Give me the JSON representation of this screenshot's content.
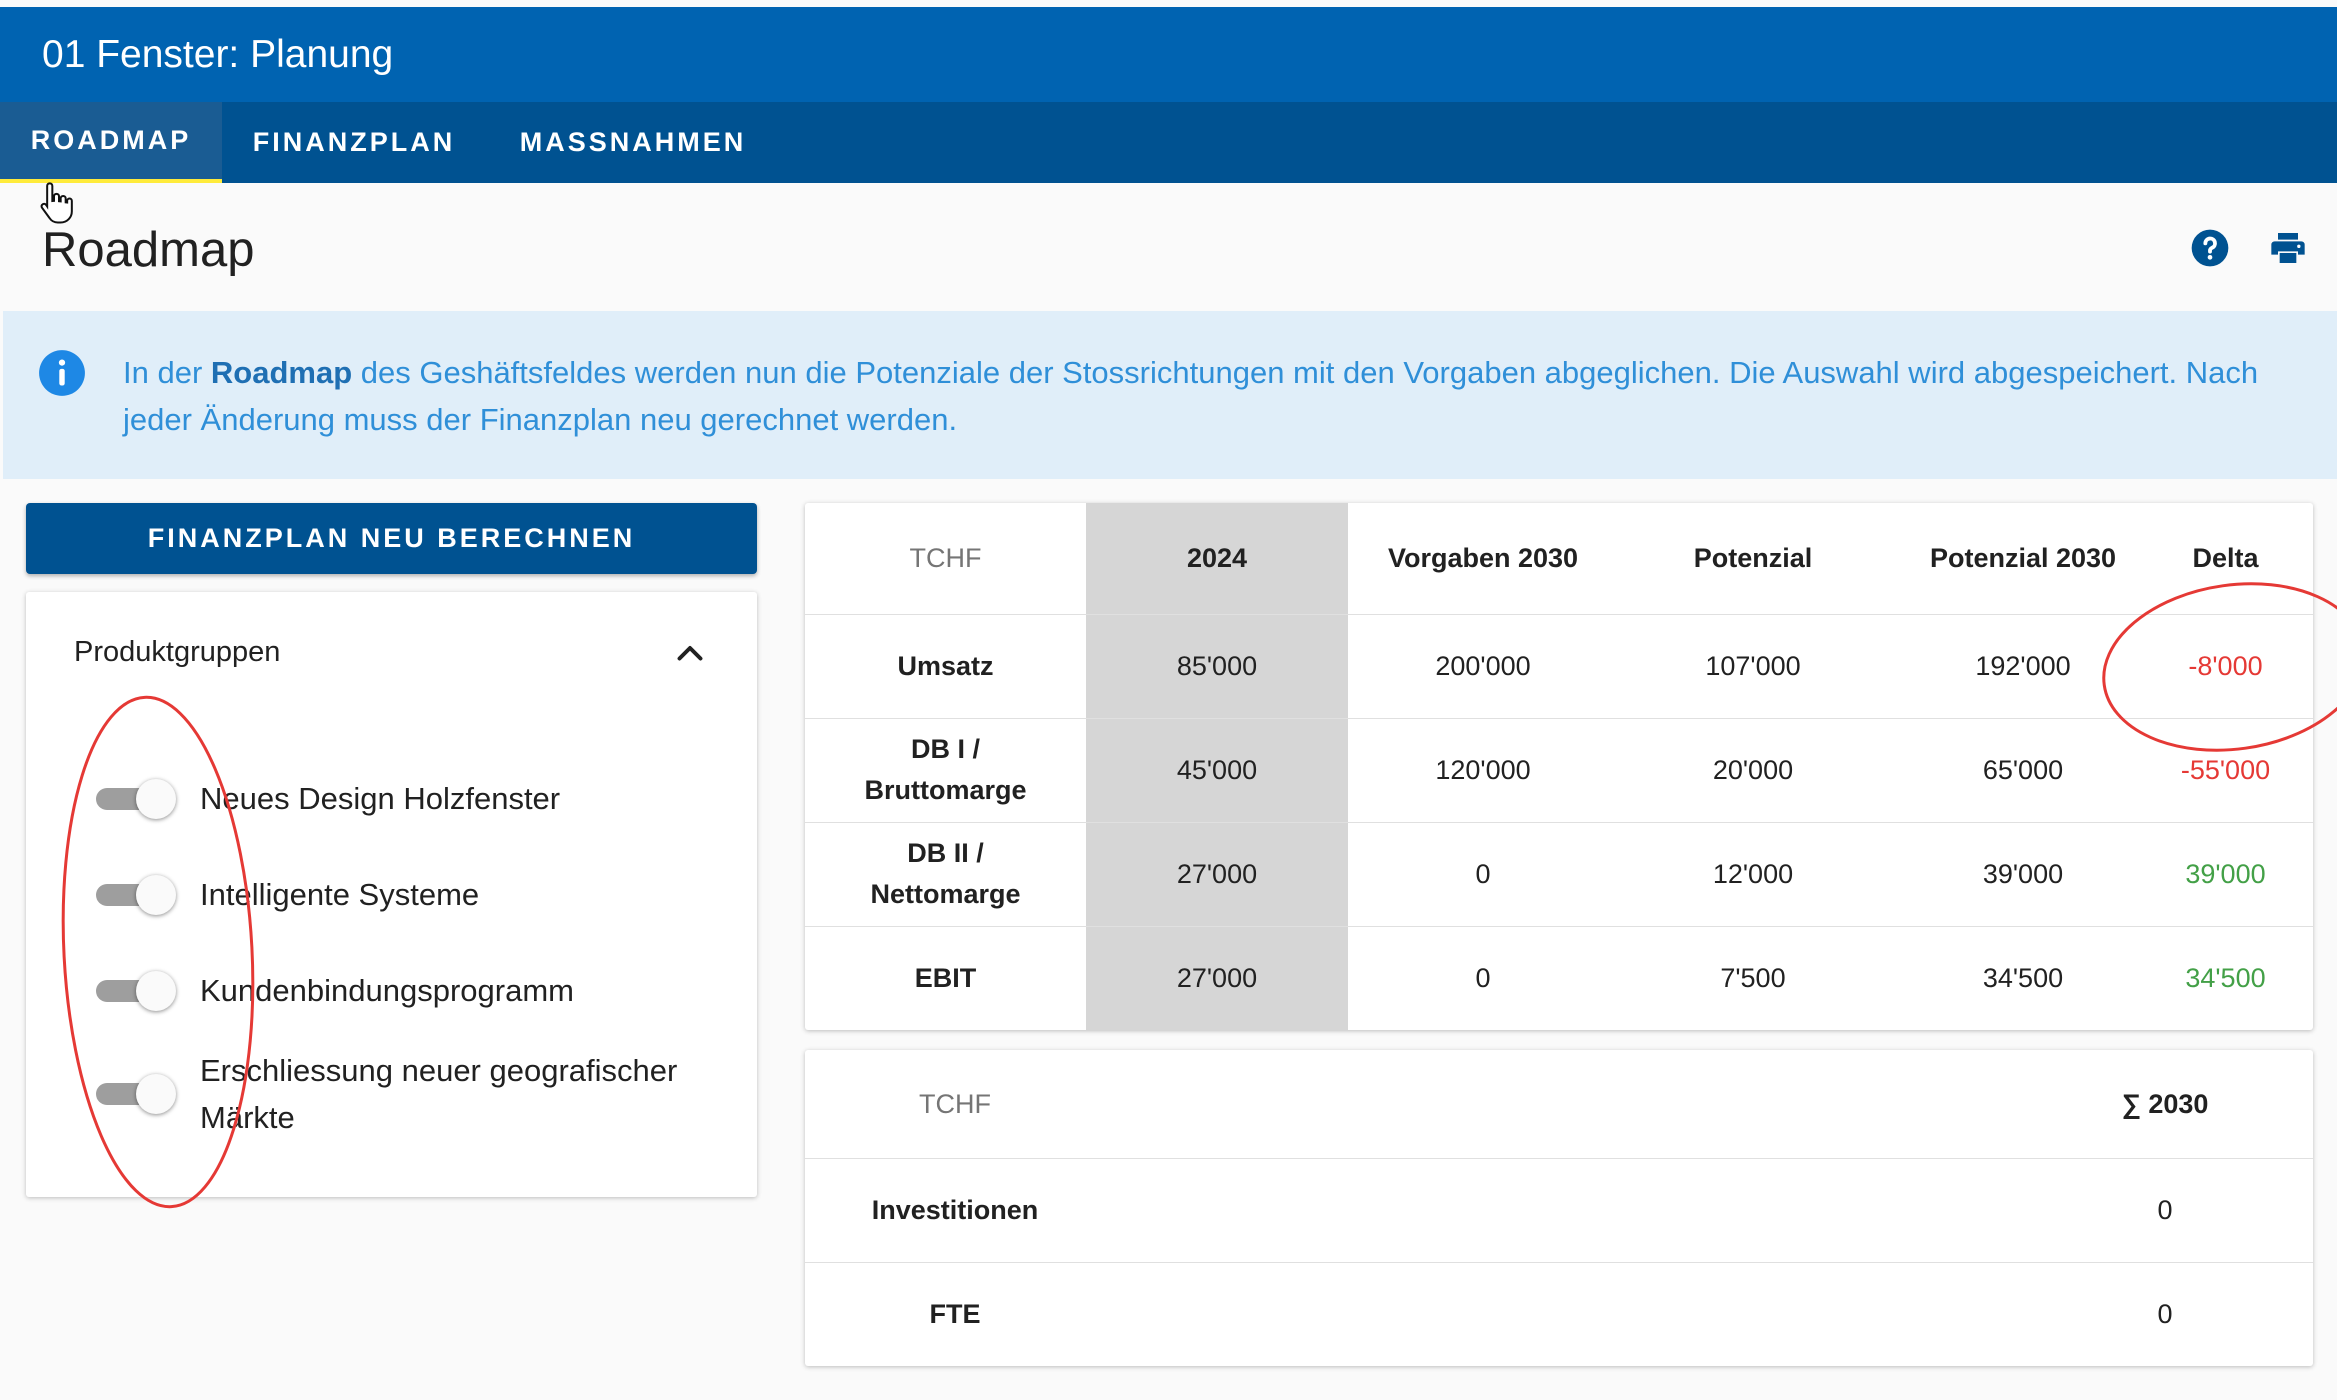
{
  "window": {
    "title": "01 Fenster: Planung"
  },
  "tabs": [
    {
      "label": "ROADMAP",
      "active": true
    },
    {
      "label": "FINANZPLAN",
      "active": false
    },
    {
      "label": "MASSNAHMEN",
      "active": false
    }
  ],
  "page": {
    "title": "Roadmap"
  },
  "info": {
    "text_before": "In der ",
    "text_bold": "Roadmap",
    "text_after": " des Geshäftsfeldes werden nun die Potenziale der Stossrichtungen mit den Vorgaben abgeglichen. Die Auswahl wird abgespeichert. Nach jeder Änderung muss der Finanzplan neu gerechnet werden."
  },
  "actions": {
    "recalc_label": "FINANZPLAN NEU BERECHNEN"
  },
  "produktgruppen": {
    "header": "Produktgruppen",
    "items": [
      {
        "label": "Neues Design Holzfenster",
        "on": false
      },
      {
        "label": "Intelligente Systeme",
        "on": false
      },
      {
        "label": "Kundenbindungsprogramm",
        "on": false
      },
      {
        "label": "Erschliessung neuer geografischer Märkte",
        "on": false
      }
    ]
  },
  "main_table": {
    "headers": [
      "TCHF",
      "2024",
      "Vorgaben 2030",
      "Potenzial",
      "Potenzial 2030",
      "Delta"
    ],
    "rows": [
      {
        "label": "Umsatz",
        "cells": [
          "85'000",
          "200'000",
          "107'000",
          "192'000",
          "-8'000"
        ],
        "delta_status": "negative"
      },
      {
        "label": "DB I / Bruttomarge",
        "cells": [
          "45'000",
          "120'000",
          "20'000",
          "65'000",
          "-55'000"
        ],
        "delta_status": "negative"
      },
      {
        "label": "DB II / Nettomarge",
        "cells": [
          "27'000",
          "0",
          "12'000",
          "39'000",
          "39'000"
        ],
        "delta_status": "positive"
      },
      {
        "label": "EBIT",
        "cells": [
          "27'000",
          "0",
          "7'500",
          "34'500",
          "34'500"
        ],
        "delta_status": "positive"
      }
    ]
  },
  "summary_table": {
    "headers": [
      "TCHF",
      "∑ 2030"
    ],
    "rows": [
      {
        "label": "Investitionen",
        "value": "0"
      },
      {
        "label": "FTE",
        "value": "0"
      }
    ]
  },
  "colors": {
    "titlebar": "#0063b1",
    "tabbar": "#005291",
    "tab_indicator": "#ffeb3b",
    "info_bg": "#e0eef9",
    "info_text": "#2f8fd8",
    "negative": "#e53935",
    "positive": "#43a047",
    "annotation": "#e53935"
  },
  "icons": [
    "pointer-hand-icon",
    "help-circle-icon",
    "print-icon",
    "info-circle-icon",
    "chevron-up-icon"
  ]
}
